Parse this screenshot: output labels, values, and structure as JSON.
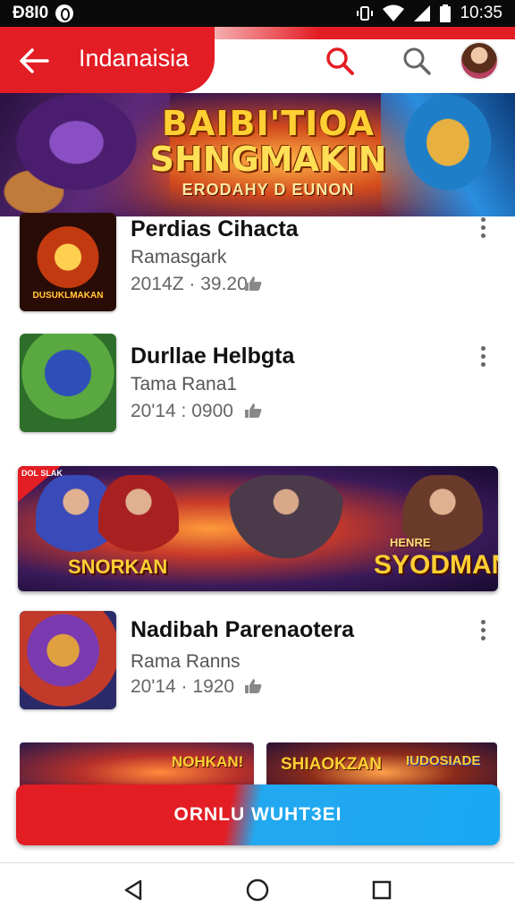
{
  "status_bar": {
    "left_text": "Đ8I0",
    "time": "10:35"
  },
  "app_bar": {
    "title": "Indanaisia",
    "back_icon": "arrow-left-icon",
    "search_icon": "search-icon",
    "accent_color": "#e31d24"
  },
  "hero": {
    "line1": "BAIBI'TIOA",
    "line2": "SHNGMAKIN",
    "line3": "ERODAHY D EUNON"
  },
  "list": [
    {
      "title": "Perdias Cihacta",
      "subtitle": "Ramasgark",
      "date": "2014Z · 39.20",
      "thumb_text": "DUSUKLMAKAN"
    },
    {
      "title": "Durllae Helbgta",
      "subtitle": "Tama Rana1",
      "date": "20'14 : 0900"
    },
    {
      "title": "Nadibah Parenaotera",
      "subtitle": "Rama Ranns",
      "date": "20'14 · 1920"
    }
  ],
  "mid_banner": {
    "tag": "DOL SLAK",
    "left_text": "SNORKAN",
    "right_small": "HENRE",
    "right_text": "SYODMAN!"
  },
  "small_banners": {
    "left_text": "NOHKAN!",
    "right_text": "SHIAOKZAN",
    "right_text2": "IUDOSIADE"
  },
  "cta": {
    "label": "ORNLU WUHT3EI"
  },
  "colors": {
    "red": "#e31d24",
    "blue": "#1aa8f2"
  }
}
